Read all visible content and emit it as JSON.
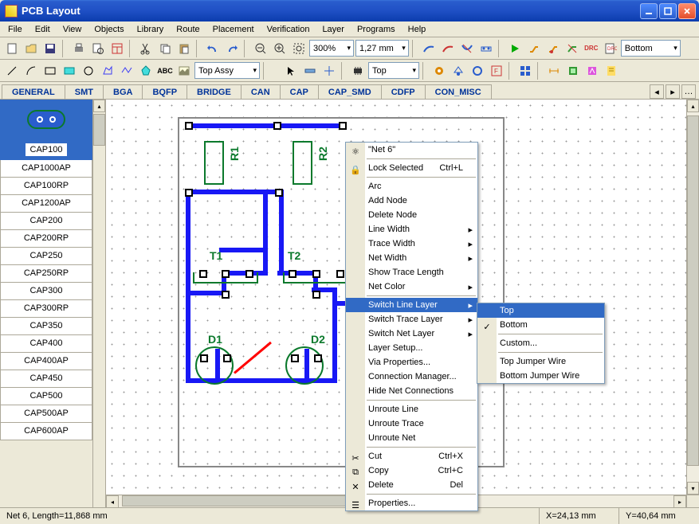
{
  "window": {
    "title": "PCB Layout"
  },
  "menubar": [
    "File",
    "Edit",
    "View",
    "Objects",
    "Library",
    "Route",
    "Placement",
    "Verification",
    "Layer",
    "Programs",
    "Help"
  ],
  "toolbar1": {
    "zoom": "300%",
    "grid": "1,27 mm",
    "layer": "Bottom"
  },
  "toolbar2": {
    "assy": "Top Assy",
    "layer2": "Top"
  },
  "tabs": [
    "GENERAL",
    "SMT",
    "BGA",
    "BQFP",
    "BRIDGE",
    "CAN",
    "CAP",
    "CAP_SMD",
    "CDFP",
    "CON_MISC"
  ],
  "components": {
    "selected": "CAP100",
    "list": [
      "CAP1000AP",
      "CAP100RP",
      "CAP1200AP",
      "CAP200",
      "CAP200RP",
      "CAP250",
      "CAP250RP",
      "CAP300",
      "CAP300RP",
      "CAP350",
      "CAP400",
      "CAP400AP",
      "CAP450",
      "CAP500",
      "CAP500AP",
      "CAP600AP"
    ]
  },
  "canvas": {
    "refs": {
      "R1": "R1",
      "R2": "R2",
      "T1": "T1",
      "T2": "T2",
      "D1": "D1",
      "D2": "D2"
    },
    "net_label": "\"Net 6\""
  },
  "context_menu": {
    "net": "\"Net 6\"",
    "lock": "Lock Selected",
    "lock_key": "Ctrl+L",
    "items": [
      "Arc",
      "Add Node",
      "Delete Node",
      "Line Width",
      "Trace Width",
      "Net Width",
      "Show Trace Length",
      "Net Color"
    ],
    "switch_line": "Switch Line Layer",
    "items2": [
      "Switch Trace Layer",
      "Switch Net Layer",
      "Layer Setup...",
      "Via Properties...",
      "Connection Manager...",
      "Hide Net Connections"
    ],
    "items3": [
      "Unroute Line",
      "Unroute Trace",
      "Unroute Net"
    ],
    "cut": "Cut",
    "cut_key": "Ctrl+X",
    "copy": "Copy",
    "copy_key": "Ctrl+C",
    "delete": "Delete",
    "del_key": "Del",
    "props": "Properties..."
  },
  "submenu": {
    "top": "Top",
    "bottom": "Bottom",
    "custom": "Custom...",
    "jw1": "Top Jumper Wire",
    "jw2": "Bottom Jumper Wire"
  },
  "statusbar": {
    "left": "Net 6, Length=11,868 mm",
    "x": "X=24,13 mm",
    "y": "Y=40,64 mm"
  }
}
